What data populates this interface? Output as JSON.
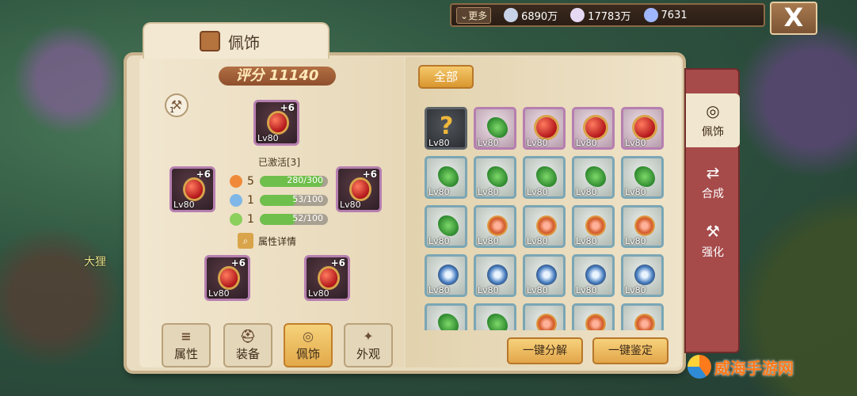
{
  "scene": {
    "npc_name": "大狸"
  },
  "resources": {
    "more_label": "更多",
    "stars": "6890万",
    "shells": "17783万",
    "crystals": "7631"
  },
  "close_label": "X",
  "panel": {
    "title": "佩饰",
    "score_label": "评分 11140",
    "hammer_count": "1"
  },
  "equip": {
    "lv": "Lv80",
    "plus": "+6",
    "activated": "已激活[3]",
    "stats": [
      {
        "num": "5",
        "value": "280/300",
        "fill": 0.93,
        "color": "#f08a3a"
      },
      {
        "num": "1",
        "value": "53/100",
        "fill": 0.53,
        "color": "#7fb8e8"
      },
      {
        "num": "1",
        "value": "52/100",
        "fill": 0.52,
        "color": "#8bcf5c"
      }
    ],
    "detail_label": "属性详情"
  },
  "bottom_tabs": [
    {
      "icon": "≡",
      "label": "属性"
    },
    {
      "icon": "⛑",
      "label": "装备"
    },
    {
      "icon": "◎",
      "label": "佩饰"
    },
    {
      "icon": "✦",
      "label": "外观"
    }
  ],
  "filter_label": "全部",
  "inventory": {
    "lv": "Lv80",
    "rows": [
      [
        "question",
        "clover",
        "red",
        "red",
        "red"
      ],
      [
        "clover",
        "clover",
        "clover",
        "clover",
        "clover"
      ],
      [
        "clover",
        "ring",
        "ring",
        "ring",
        "ring"
      ],
      [
        "wave",
        "wave",
        "wave",
        "wave",
        "wave"
      ],
      [
        "clover",
        "clover",
        "ring",
        "ring",
        "ring"
      ]
    ]
  },
  "actions": {
    "decompose": "一键分解",
    "identify": "一键鉴定"
  },
  "side_tabs": [
    {
      "icon": "◎",
      "label": "佩饰"
    },
    {
      "icon": "⇄",
      "label": "合成"
    },
    {
      "icon": "⚒",
      "label": "强化"
    }
  ],
  "watermark": "威海手游网"
}
